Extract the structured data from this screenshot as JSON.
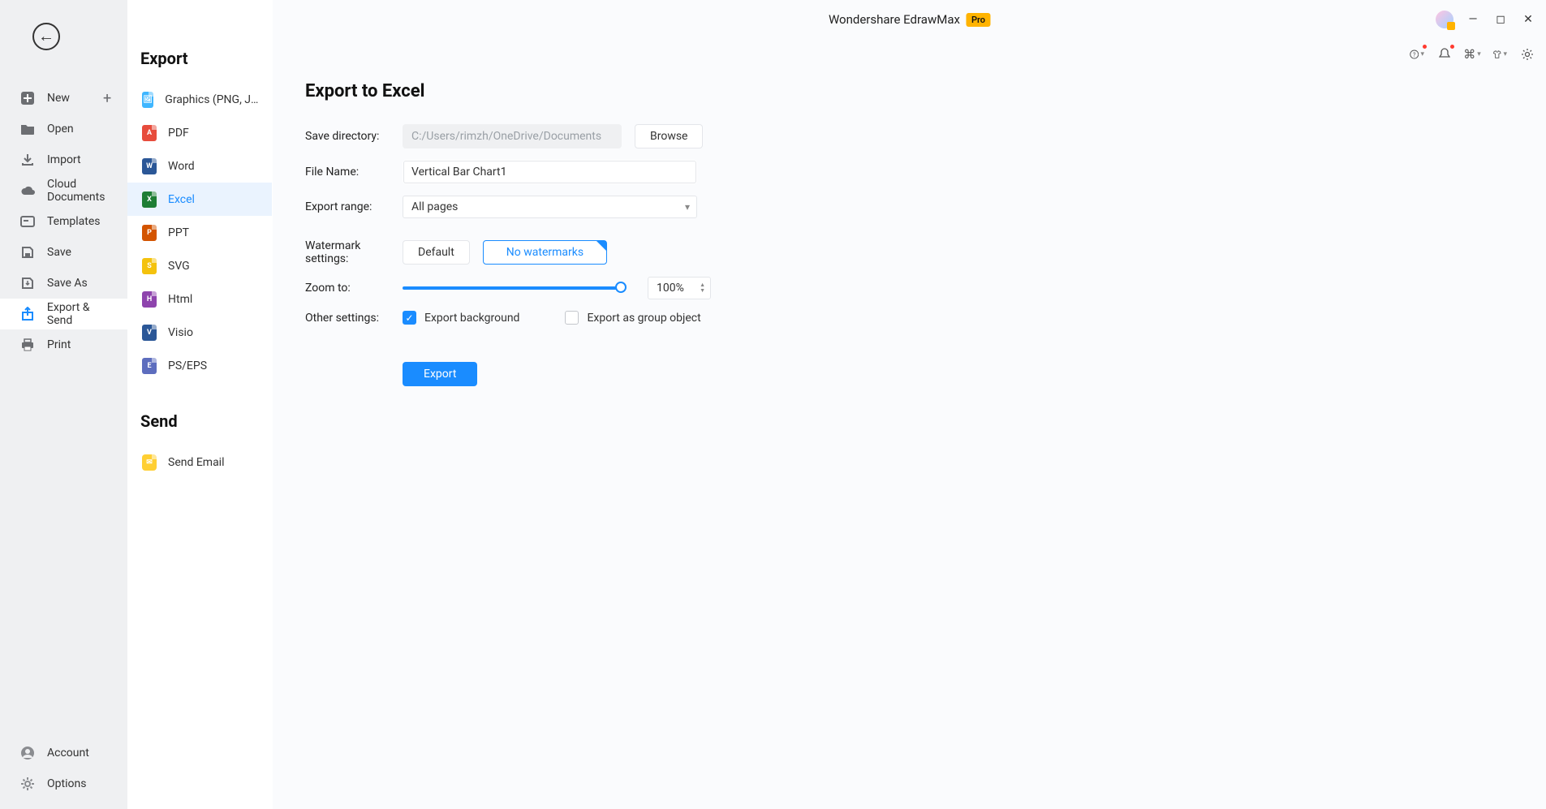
{
  "app": {
    "title": "Wondershare EdrawMax",
    "badge": "Pro"
  },
  "sidebar": {
    "items": [
      {
        "id": "new",
        "label": "New",
        "has_plus": true
      },
      {
        "id": "open",
        "label": "Open"
      },
      {
        "id": "import",
        "label": "Import"
      },
      {
        "id": "cloud",
        "label": "Cloud Documents"
      },
      {
        "id": "templates",
        "label": "Templates"
      },
      {
        "id": "save",
        "label": "Save"
      },
      {
        "id": "saveas",
        "label": "Save As"
      },
      {
        "id": "exportsend",
        "label": "Export & Send",
        "active": true
      },
      {
        "id": "print",
        "label": "Print"
      }
    ],
    "bottom": [
      {
        "id": "account",
        "label": "Account"
      },
      {
        "id": "options",
        "label": "Options"
      }
    ]
  },
  "export_list": {
    "title": "Export",
    "items": [
      {
        "id": "graphics",
        "label": "Graphics (PNG, JPG et...",
        "color": "#3fb6ff",
        "glyph": "🖼"
      },
      {
        "id": "pdf",
        "label": "PDF",
        "color": "#e74c3c",
        "glyph": "A"
      },
      {
        "id": "word",
        "label": "Word",
        "color": "#2b5797",
        "glyph": "W"
      },
      {
        "id": "excel",
        "label": "Excel",
        "color": "#1e7e34",
        "glyph": "X",
        "active": true
      },
      {
        "id": "ppt",
        "label": "PPT",
        "color": "#d35400",
        "glyph": "P"
      },
      {
        "id": "svg",
        "label": "SVG",
        "color": "#f4c20d",
        "glyph": "S"
      },
      {
        "id": "html",
        "label": "Html",
        "color": "#8e44ad",
        "glyph": "H"
      },
      {
        "id": "visio",
        "label": "Visio",
        "color": "#2b5797",
        "glyph": "V"
      },
      {
        "id": "pseps",
        "label": "PS/EPS",
        "color": "#5d6dbe",
        "glyph": "E"
      }
    ],
    "send_title": "Send",
    "send_items": [
      {
        "id": "sendemail",
        "label": "Send Email",
        "color": "#ffcf33",
        "glyph": "✉"
      }
    ]
  },
  "form": {
    "page_title": "Export to Excel",
    "save_dir_label": "Save directory:",
    "save_dir_value": "C:/Users/rimzh/OneDrive/Documents",
    "browse_label": "Browse",
    "file_name_label": "File Name:",
    "file_name_value": "Vertical Bar Chart1",
    "export_range_label": "Export range:",
    "export_range_value": "All pages",
    "watermark_label": "Watermark settings:",
    "watermark_default_label": "Default",
    "watermark_none_label": "No watermarks",
    "zoom_label": "Zoom to:",
    "zoom_value": "100%",
    "other_label": "Other settings:",
    "export_bg_label": "Export background",
    "export_bg_checked": true,
    "export_group_label": "Export as group object",
    "export_group_checked": false,
    "export_button": "Export"
  }
}
